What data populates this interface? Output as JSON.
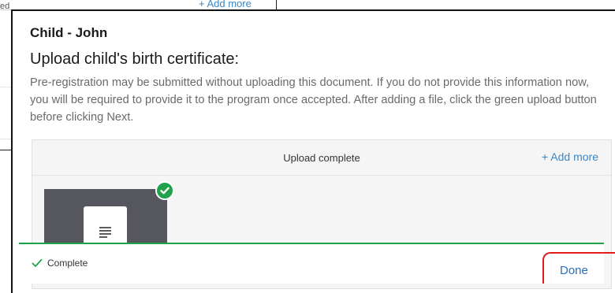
{
  "background": {
    "cut_text": "ed",
    "add_more_label": "+ Add more"
  },
  "modal": {
    "child_name": "Child - John",
    "upload_title": "Upload child's birth certificate:",
    "instructions": "Pre-registration may be submitted without uploading this document. If you do not provide this information now, you will be required to provide it to the program once accepted. After adding a file, click the green upload button before clicking Next."
  },
  "uploader": {
    "status_text": "Upload complete",
    "add_more_label": "+ Add more",
    "file_icon": "document-icon",
    "badge_icon": "checkmark-badge-icon",
    "footer_status": "Complete",
    "done_label": "Done"
  },
  "colors": {
    "accent_green": "#1fa24a",
    "link_blue": "#3b86c4",
    "highlight_red": "#e41b1b"
  }
}
